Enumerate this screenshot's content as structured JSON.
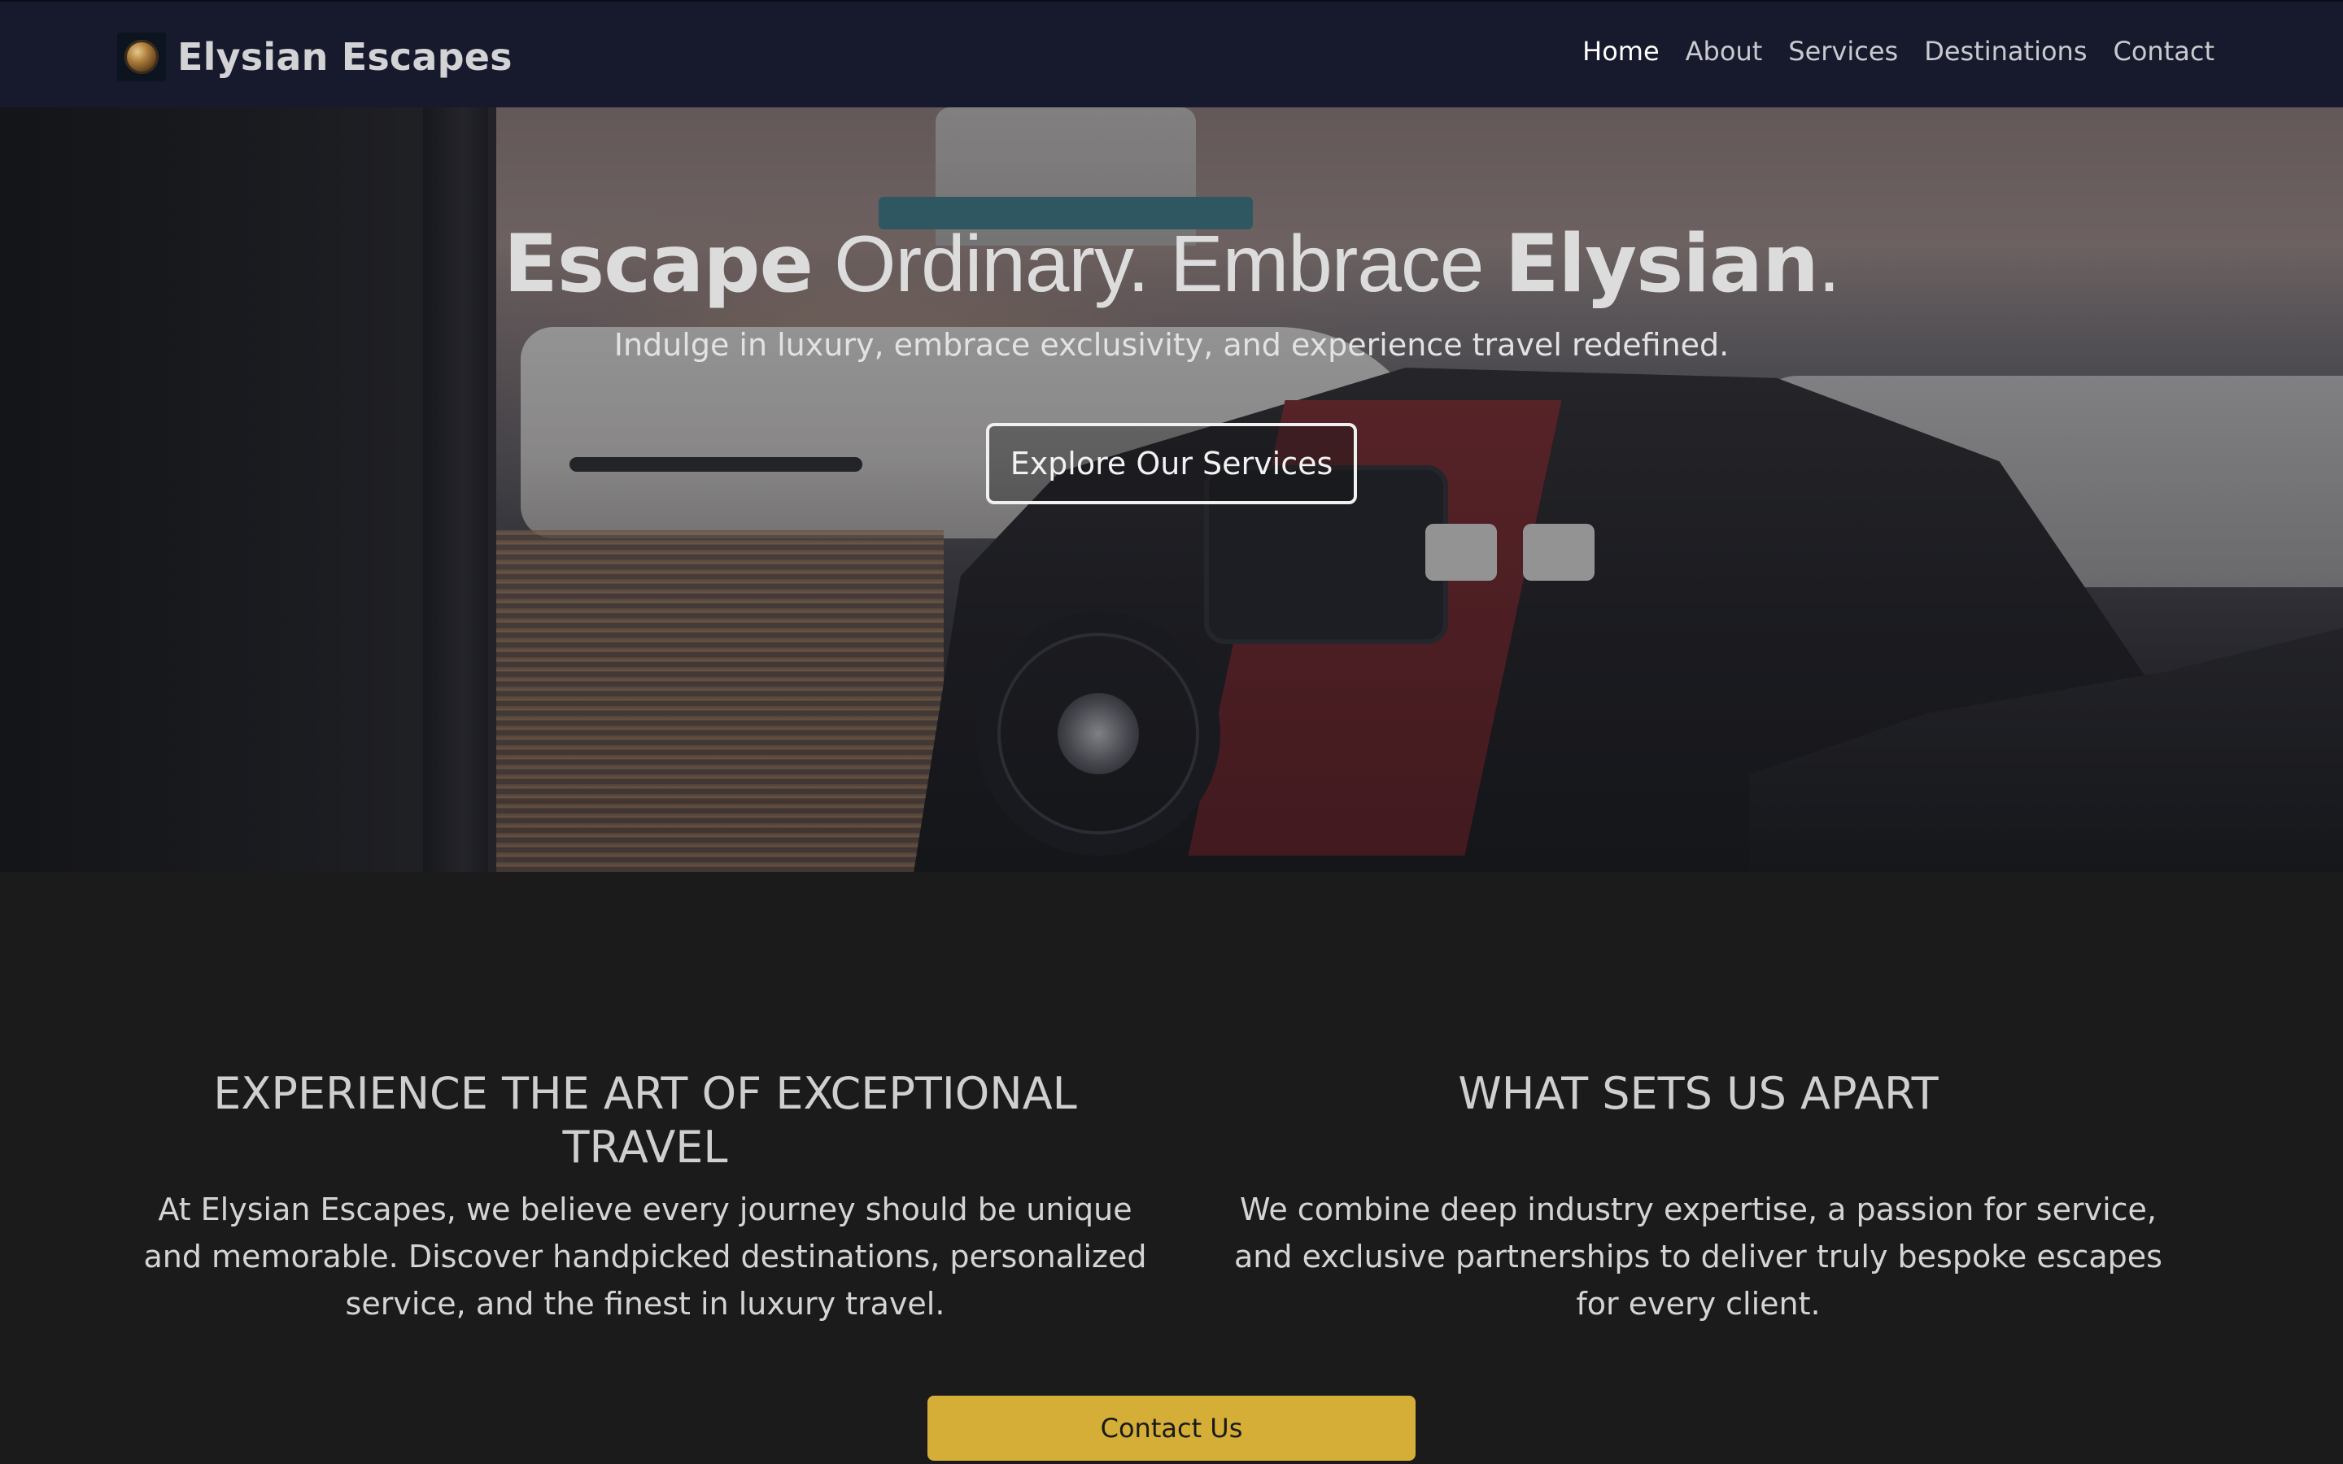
{
  "nav": {
    "brand_name": "Elysian Escapes",
    "logo_icon": "globe-logo-icon",
    "links": [
      {
        "label": "Home",
        "active": true
      },
      {
        "label": "About",
        "active": false
      },
      {
        "label": "Services",
        "active": false
      },
      {
        "label": "Destinations",
        "active": false
      },
      {
        "label": "Contact",
        "active": false
      }
    ]
  },
  "hero": {
    "title_part1": "Escape",
    "title_part2": " Ordinary. Embrace ",
    "title_part3": "Elysian",
    "title_part4": ".",
    "subtitle": "Indulge in luxury, embrace exclusivity, and experience travel redefined.",
    "button_label": "Explore Our Services"
  },
  "sections": {
    "left": {
      "heading": "EXPERIENCE THE ART OF EXCEPTIONAL TRAVEL",
      "text": "At Elysian Escapes, we believe every journey should be unique and memorable. Discover handpicked destinations, personalized service, and the finest in luxury travel."
    },
    "right": {
      "heading": "WHAT SETS US APART",
      "text": "We combine deep industry expertise, a passion for service, and exclusive partnerships to deliver truly bespoke escapes for every client."
    }
  },
  "cta": {
    "label": "Contact Us"
  },
  "colors": {
    "navbar_bg": "#161a2c",
    "page_bg": "#1b1b1b",
    "accent_gold": "#d4ae36"
  }
}
